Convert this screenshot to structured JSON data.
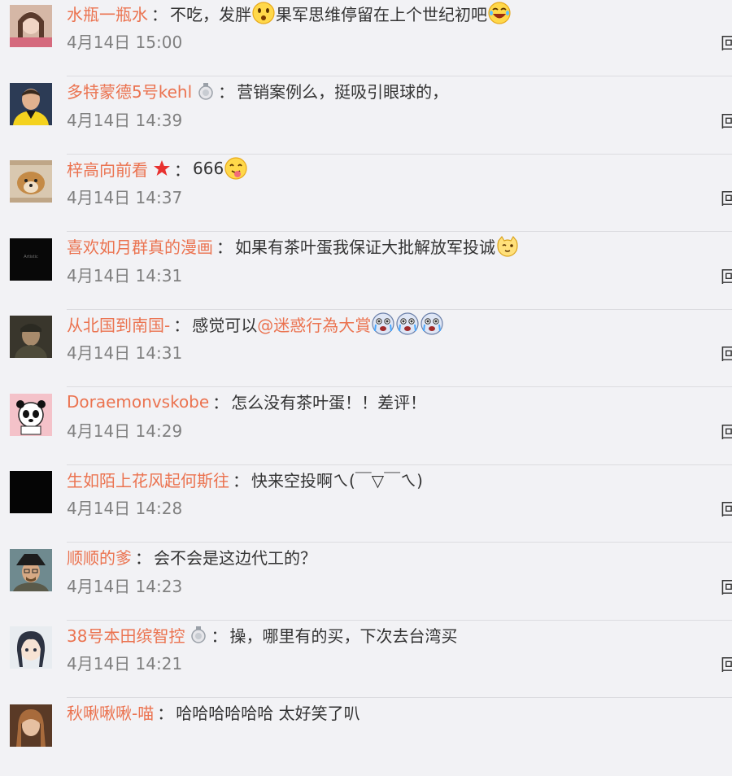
{
  "comments": [
    {
      "user": "水瓶一瓶水",
      "segments": [
        {
          "kind": "text",
          "value": "不吃，发胖"
        },
        {
          "kind": "emoji",
          "icon": "surprised-emoji-icon"
        },
        {
          "kind": "text",
          "value": "果军思维停留在上个世纪初吧"
        },
        {
          "kind": "emoji",
          "icon": "laughing-emoji-icon"
        }
      ],
      "time": "4月14日 15:00",
      "avatar": "avatar-girl",
      "badge": null
    },
    {
      "user": "多特蒙德5号kehl",
      "segments": [
        {
          "kind": "text",
          "value": "营销案例么，挺吸引眼球的，"
        }
      ],
      "time": "4月14日 14:39",
      "avatar": "avatar-footballer",
      "badge": "member-medal-icon"
    },
    {
      "user": "梓高向前看",
      "segments": [
        {
          "kind": "text",
          "value": "666"
        },
        {
          "kind": "emoji",
          "icon": "tongue-emoji-icon"
        }
      ],
      "time": "4月14日 14:37",
      "avatar": "avatar-dog",
      "badge": "red-star-icon"
    },
    {
      "user": "喜欢如月群真的漫画",
      "segments": [
        {
          "kind": "text",
          "value": "如果有茶叶蛋我保证大批解放军投诚"
        },
        {
          "kind": "emoji",
          "icon": "cat-emoji-icon"
        }
      ],
      "time": "4月14日 14:31",
      "avatar": "avatar-black-text",
      "badge": null
    },
    {
      "user": "从北国到南国-",
      "segments": [
        {
          "kind": "text",
          "value": "感觉可以"
        },
        {
          "kind": "mention",
          "value": "@迷惑行為大賞"
        },
        {
          "kind": "emoji",
          "icon": "crying-emoji-icon"
        },
        {
          "kind": "emoji",
          "icon": "crying-emoji-icon"
        },
        {
          "kind": "emoji",
          "icon": "crying-emoji-icon"
        }
      ],
      "time": "4月14日 14:31",
      "avatar": "avatar-soldier",
      "badge": null
    },
    {
      "user": "Doraemonvskobe",
      "segments": [
        {
          "kind": "text",
          "value": "怎么没有茶叶蛋！！差评！"
        }
      ],
      "time": "4月14日 14:29",
      "avatar": "avatar-panda",
      "badge": null
    },
    {
      "user": "生如陌上花风起何斯往",
      "segments": [
        {
          "kind": "text",
          "value": "快来空投啊ㄟ(￣▽￣ㄟ)"
        }
      ],
      "time": "4月14日 14:28",
      "avatar": "avatar-black",
      "badge": null
    },
    {
      "user": "顺顺的爹",
      "segments": [
        {
          "kind": "text",
          "value": "会不会是这边代工的？"
        }
      ],
      "time": "4月14日 14:23",
      "avatar": "avatar-heisenberg",
      "badge": null
    },
    {
      "user": "38号本田缤智控",
      "segments": [
        {
          "kind": "text",
          "value": "操，哪里有的买，下次去台湾买"
        }
      ],
      "time": "4月14日 14:21",
      "avatar": "avatar-anime-girl",
      "badge": "member-medal-icon"
    },
    {
      "user": "秋啾啾啾-喵",
      "segments": [
        {
          "kind": "text",
          "value": "哈哈哈哈哈哈 太好笑了叭"
        }
      ],
      "time": "",
      "avatar": "avatar-woman",
      "badge": null
    }
  ],
  "reply_label": "回",
  "colors": {
    "username": "#eb7350",
    "text": "#333333",
    "time": "#808080",
    "background": "#f2f2f5"
  }
}
